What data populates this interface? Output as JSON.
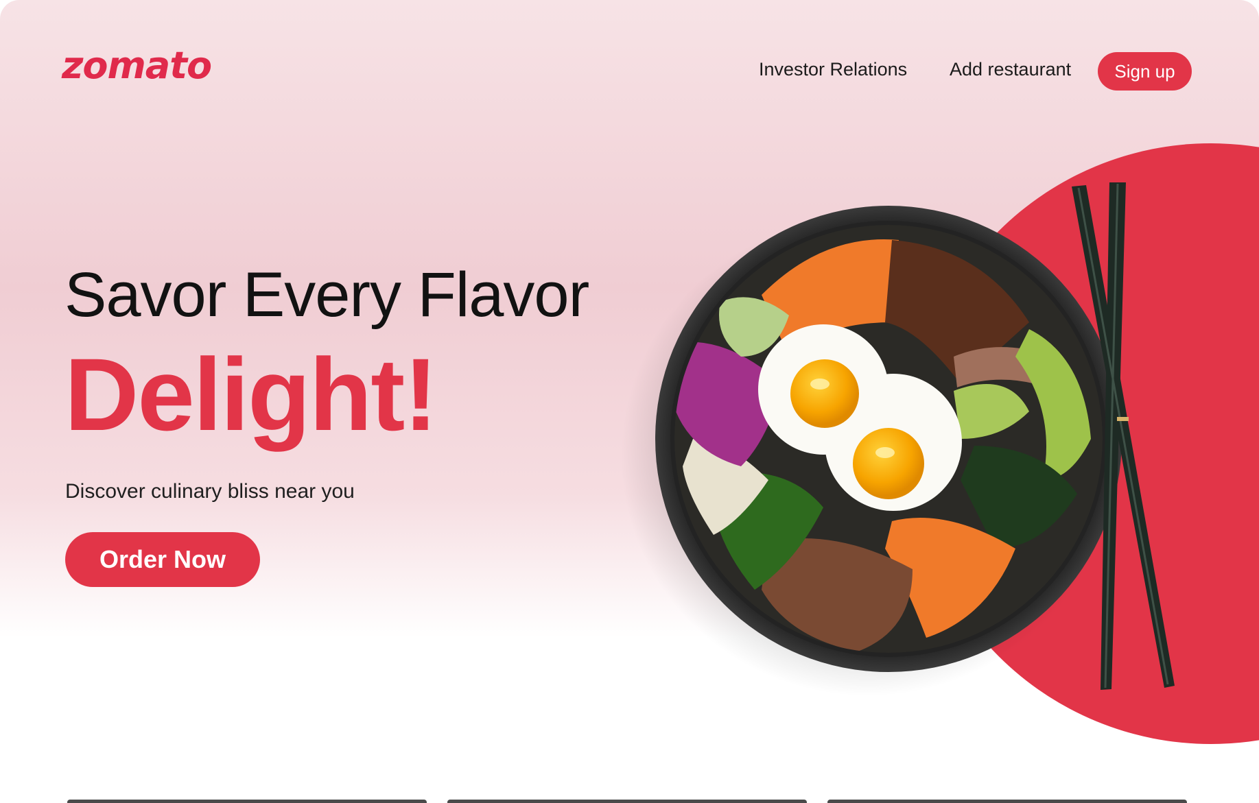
{
  "header": {
    "logo": "zomato",
    "nav": {
      "investor_relations": "Investor Relations",
      "add_restaurant": "Add restaurant",
      "sign_up": "Sign up"
    }
  },
  "hero": {
    "headline": "Savor Every Flavor",
    "highlight": "Delight!",
    "tagline": "Discover culinary bliss near you",
    "cta": "Order Now"
  },
  "colors": {
    "brand": "#e23548",
    "logo": "#e02a4b",
    "text": "#121212"
  },
  "icons": {
    "hero_image": "bibimbap-bowl-with-chopsticks"
  }
}
